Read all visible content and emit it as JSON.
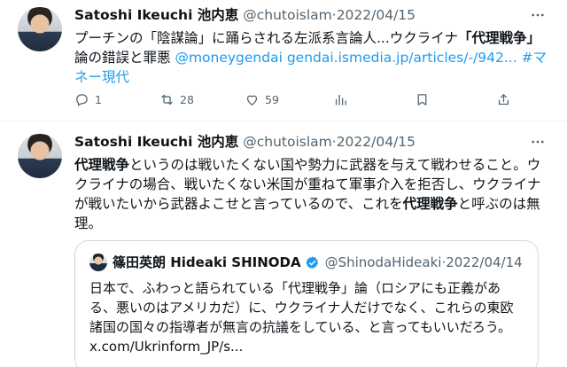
{
  "tweets": [
    {
      "name": "Satoshi Ikeuchi 池内恵",
      "handle": "@chutoislam",
      "separator": "·",
      "date": "2022/04/15",
      "text_part1": "プーチンの「陰謀論」に踊らされる左派系言論人...ウクライナ",
      "text_bold": "「代理戦争」",
      "text_part2": "論の錯誤と罪悪 ",
      "text_link": "@moneygendai gendai.ismedia.jp/articles/-/942... #マネー現代",
      "actions": {
        "replies": "1",
        "retweets": "28",
        "likes": "59",
        "views": "",
        "bookmark": "",
        "share": ""
      }
    },
    {
      "name": "Satoshi Ikeuchi 池内恵",
      "handle": "@chutoislam",
      "separator": "·",
      "date": "2022/04/15",
      "text_bold1": "代理戦争",
      "text_part1": "というのは戦いたくない国や勢力に武器を与えて戦わせること。ウクライナの場合、戦いたくない米国が重ねて軍事介入を拒否し、ウクライナが戦いたいから武器よこせと言っているので、これを",
      "text_bold2": "代理戦争",
      "text_part2": "と呼ぶのは無理。",
      "quote": {
        "name": "篠田英朗 Hideaki SHINODA",
        "handle": "@ShinodaHideaki",
        "separator": "·",
        "date": "2022/04/14",
        "text": "日本で、ふわっと語られている「代理戦争」論（ロシアにも正義がある、悪いのはアメリカだ）に、ウクライナ人だけでなく、これらの東欧諸国の国々の指導者が無言の抗議をしている、と言ってもいいだろう。 x.com/Ukrinform_JP/s..."
      }
    }
  ],
  "colors": {
    "link": "#1d9bf0",
    "muted": "#536471",
    "text": "#0f1419",
    "border": "#cfd9de",
    "verified": "#1d9bf0"
  },
  "icons": [
    "more-icon",
    "reply-icon",
    "retweet-icon",
    "like-icon",
    "views-icon",
    "bookmark-icon",
    "share-icon",
    "verified-badge-icon"
  ]
}
